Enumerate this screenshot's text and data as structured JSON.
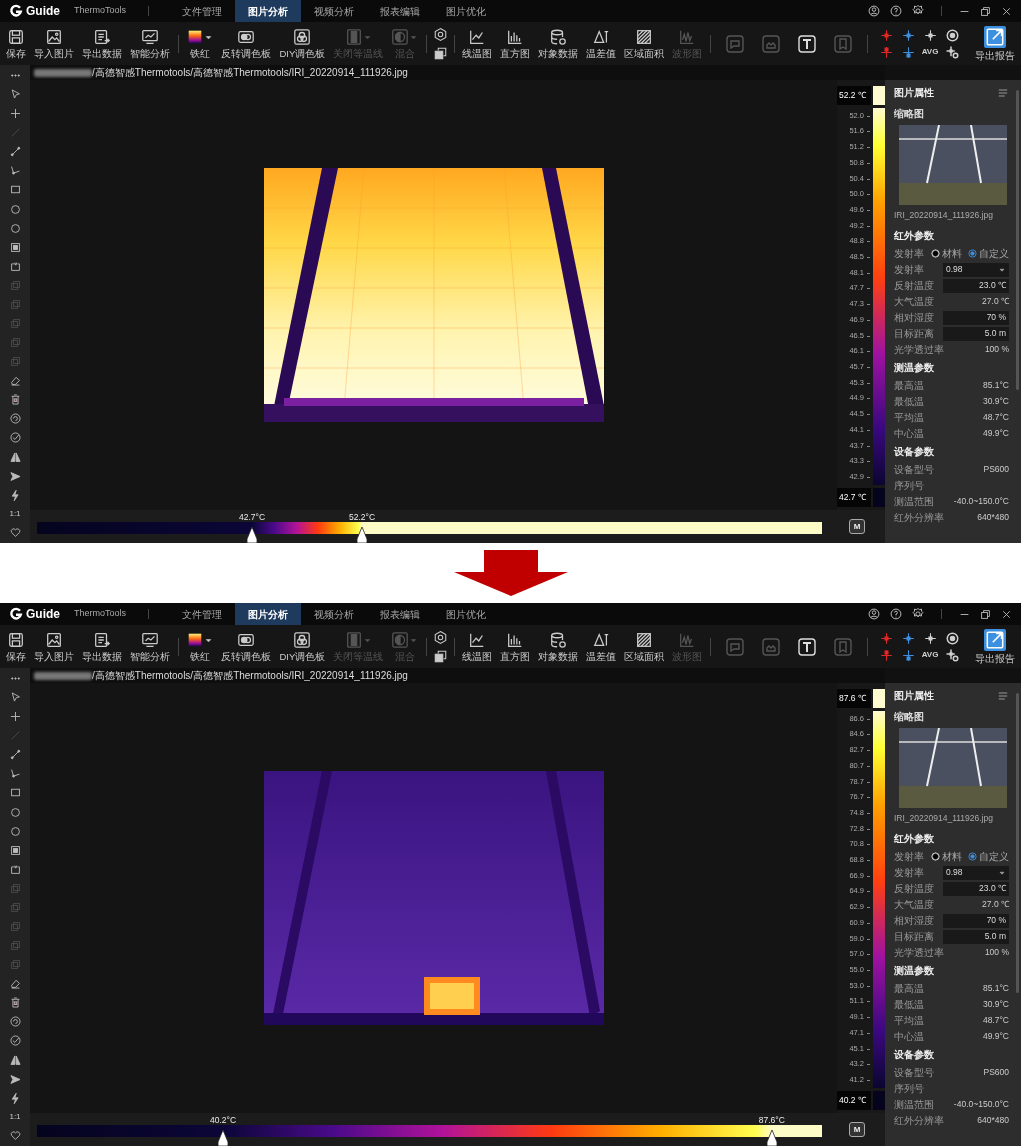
{
  "screens": [
    {
      "title_bar": {
        "logo_text": "Guide",
        "app_name": "ThermoTools",
        "tabs": [
          {
            "label": "文件管理",
            "selected": false
          },
          {
            "label": "图片分析",
            "selected": true
          },
          {
            "label": "视频分析",
            "selected": false
          },
          {
            "label": "报表编辑",
            "selected": false
          },
          {
            "label": "图片优化",
            "selected": false
          }
        ]
      },
      "toolbar": {
        "groups": [
          {
            "kind": "labeled",
            "items": [
              {
                "label": "保存",
                "disabled": false
              },
              {
                "label": "导入图片",
                "disabled": false
              },
              {
                "label": "导出数据",
                "disabled": false
              },
              {
                "label": "智能分析",
                "disabled": false
              }
            ]
          },
          {
            "kind": "labeled",
            "items": [
              {
                "label": "铁红",
                "disabled": false,
                "dropdown": true
              },
              {
                "label": "反转调色板",
                "disabled": false
              },
              {
                "label": "DIY调色板",
                "disabled": false
              },
              {
                "label": "关闭等温线",
                "disabled": true,
                "dropdown": true
              },
              {
                "label": "混合",
                "disabled": true,
                "dropdown": true
              }
            ]
          },
          {
            "kind": "stack",
            "items": [
              {
                "disabled": false
              },
              {
                "disabled": false
              }
            ]
          },
          {
            "kind": "labeled",
            "items": [
              {
                "label": "线温图",
                "disabled": false
              },
              {
                "label": "直方图",
                "disabled": false
              },
              {
                "label": "对象数据",
                "disabled": false
              },
              {
                "label": "温差值",
                "disabled": false
              },
              {
                "label": "区域面积",
                "disabled": false
              },
              {
                "label": "波形图",
                "disabled": true
              }
            ]
          },
          {
            "kind": "framed",
            "items": [
              {
                "disabled": true
              },
              {
                "disabled": true
              },
              {
                "disabled": false
              },
              {
                "disabled": true
              }
            ]
          },
          {
            "kind": "grid",
            "items": [
              {
                "color": "#e02828"
              },
              {
                "color": "#3d8fe0"
              },
              {
                "color": "#d0d0d0"
              },
              {
                "color": "#d0d0d0"
              },
              {
                "color": "#e02828"
              },
              {
                "color": "#3d8fe0"
              },
              {
                "text": "AVG",
                "color": "#d0d0d0"
              },
              {
                "color": "#d0d0d0"
              }
            ]
          },
          {
            "kind": "primary",
            "items": [
              {
                "label": "导出报告"
              }
            ]
          }
        ]
      },
      "left_tools": [
        {
          "disabled": false
        },
        {
          "disabled": false
        },
        {
          "disabled": false
        },
        {
          "disabled": true
        },
        {
          "disabled": false
        },
        {
          "disabled": false
        },
        {
          "disabled": false
        },
        {
          "disabled": false
        },
        {
          "disabled": false
        },
        {
          "disabled": false
        },
        {
          "disabled": false
        },
        {
          "disabled": true
        },
        {
          "disabled": true
        },
        {
          "disabled": true
        },
        {
          "disabled": true
        },
        {
          "disabled": true
        },
        {
          "disabled": false
        },
        {
          "disabled": false
        },
        {
          "disabled": false
        },
        {
          "disabled": false
        },
        {
          "disabled": false
        },
        {
          "disabled": false
        },
        {
          "disabled": false
        },
        {
          "text": "1:1",
          "disabled": false
        },
        {
          "disabled": false
        }
      ],
      "file_path": "/高德智感Thermotools/高德智感Thermotools/IRI_20220914_111926.jpg",
      "thermal_image": {
        "kind": "saturated"
      },
      "color_scale": {
        "max": "52.2 ℃",
        "min": "42.7 ℃",
        "ticks": [
          "52.0",
          "51.6",
          "51.2",
          "50.8",
          "50.4",
          "50.0",
          "49.6",
          "49.2",
          "48.8",
          "48.5",
          "48.1",
          "47.7",
          "47.3",
          "46.9",
          "46.5",
          "46.1",
          "45.7",
          "45.3",
          "44.9",
          "44.5",
          "44.1",
          "43.7",
          "43.3",
          "42.9"
        ]
      },
      "palette_bar": {
        "markers": [
          {
            "label": "42.7°C",
            "level": 0.274
          },
          {
            "label": "52.2°C",
            "level": 0.414
          }
        ],
        "mode_button": "M"
      },
      "properties": {
        "title": "图片属性",
        "thumbnail_label": "缩略图",
        "file_name": "IRI_20220914_111926.jpg",
        "sections": [
          {
            "title": "红外参数",
            "rows": [
              {
                "kind": "radio",
                "label": "发射率",
                "options": [
                  {
                    "label": "材料",
                    "selected": false
                  },
                  {
                    "label": "自定义",
                    "selected": true
                  }
                ]
              },
              {
                "kind": "select",
                "label": "发射率",
                "value": "0.98"
              },
              {
                "kind": "field",
                "label": "反射温度",
                "value": "23.0 ℃"
              },
              {
                "kind": "plain",
                "label": "大气温度",
                "value": "27.0 ℃"
              },
              {
                "kind": "field",
                "label": "相对湿度",
                "value": "70 %"
              },
              {
                "kind": "field",
                "label": "目标距离",
                "value": "5.0 m"
              },
              {
                "kind": "plain",
                "label": "光学透过率",
                "value": "100 %"
              }
            ]
          },
          {
            "title": "测温参数",
            "rows": [
              {
                "kind": "plain",
                "label": "最高温",
                "value": "85.1°C"
              },
              {
                "kind": "plain",
                "label": "最低温",
                "value": "30.9°C"
              },
              {
                "kind": "plain",
                "label": "平均温",
                "value": "48.7°C"
              },
              {
                "kind": "plain",
                "label": "中心温",
                "value": "49.9°C"
              }
            ]
          },
          {
            "title": "设备参数",
            "rows": [
              {
                "kind": "plain",
                "label": "设备型号",
                "value": "PS600"
              },
              {
                "kind": "plain",
                "label": "序列号"
              },
              {
                "kind": "plain",
                "label": "测温范围",
                "value": "-40.0~150.0°C"
              },
              {
                "kind": "plain",
                "label": "红外分辨率",
                "value": "640*480"
              }
            ]
          }
        ]
      }
    },
    {
      "title_bar": {
        "logo_text": "Guide",
        "app_name": "ThermoTools",
        "tabs": [
          {
            "label": "文件管理",
            "selected": false
          },
          {
            "label": "图片分析",
            "selected": true
          },
          {
            "label": "视频分析",
            "selected": false
          },
          {
            "label": "报表编辑",
            "selected": false
          },
          {
            "label": "图片优化",
            "selected": false
          }
        ]
      },
      "toolbar": {
        "groups": [
          {
            "kind": "labeled",
            "items": [
              {
                "label": "保存",
                "disabled": false
              },
              {
                "label": "导入图片",
                "disabled": false
              },
              {
                "label": "导出数据",
                "disabled": false
              },
              {
                "label": "智能分析",
                "disabled": false
              }
            ]
          },
          {
            "kind": "labeled",
            "items": [
              {
                "label": "铁红",
                "disabled": false,
                "dropdown": true
              },
              {
                "label": "反转调色板",
                "disabled": false
              },
              {
                "label": "DIY调色板",
                "disabled": false
              },
              {
                "label": "关闭等温线",
                "disabled": true,
                "dropdown": true
              },
              {
                "label": "混合",
                "disabled": true,
                "dropdown": true
              }
            ]
          },
          {
            "kind": "stack",
            "items": [
              {
                "disabled": false
              },
              {
                "disabled": false
              }
            ]
          },
          {
            "kind": "labeled",
            "items": [
              {
                "label": "线温图",
                "disabled": false
              },
              {
                "label": "直方图",
                "disabled": false
              },
              {
                "label": "对象数据",
                "disabled": false
              },
              {
                "label": "温差值",
                "disabled": false
              },
              {
                "label": "区域面积",
                "disabled": false
              },
              {
                "label": "波形图",
                "disabled": true
              }
            ]
          },
          {
            "kind": "framed",
            "items": [
              {
                "disabled": true
              },
              {
                "disabled": true
              },
              {
                "disabled": false
              },
              {
                "disabled": true
              }
            ]
          },
          {
            "kind": "grid",
            "items": [
              {
                "color": "#e02828"
              },
              {
                "color": "#3d8fe0"
              },
              {
                "color": "#d0d0d0"
              },
              {
                "color": "#d0d0d0"
              },
              {
                "color": "#e02828"
              },
              {
                "color": "#3d8fe0"
              },
              {
                "text": "AVG",
                "color": "#d0d0d0"
              },
              {
                "color": "#d0d0d0"
              }
            ]
          },
          {
            "kind": "primary",
            "items": [
              {
                "label": "导出报告"
              }
            ]
          }
        ]
      },
      "left_tools": [
        {
          "disabled": false
        },
        {
          "disabled": false
        },
        {
          "disabled": false
        },
        {
          "disabled": true
        },
        {
          "disabled": false
        },
        {
          "disabled": false
        },
        {
          "disabled": false
        },
        {
          "disabled": false
        },
        {
          "disabled": false
        },
        {
          "disabled": false
        },
        {
          "disabled": false
        },
        {
          "disabled": true
        },
        {
          "disabled": true
        },
        {
          "disabled": true
        },
        {
          "disabled": true
        },
        {
          "disabled": true
        },
        {
          "disabled": false
        },
        {
          "disabled": false
        },
        {
          "disabled": false
        },
        {
          "disabled": false
        },
        {
          "disabled": false
        },
        {
          "disabled": false
        },
        {
          "disabled": false
        },
        {
          "text": "1:1",
          "disabled": false
        },
        {
          "disabled": false
        }
      ],
      "file_path": "/高德智感Thermotools/高德智感Thermotools/IRI_20220914_111926.jpg",
      "thermal_image": {
        "kind": "hotspot"
      },
      "color_scale": {
        "max": "87.6 ℃",
        "min": "40.2 ℃",
        "ticks": [
          "86.6",
          "84.6",
          "82.7",
          "80.7",
          "78.7",
          "76.7",
          "74.8",
          "72.8",
          "70.8",
          "68.8",
          "66.9",
          "64.9",
          "62.9",
          "60.9",
          "59.0",
          "57.0",
          "55.0",
          "53.0",
          "51.1",
          "49.1",
          "47.1",
          "45.1",
          "43.2",
          "41.2"
        ]
      },
      "palette_bar": {
        "markers": [
          {
            "label": "40.2°C",
            "level": 0.237
          },
          {
            "label": "87.6°C",
            "level": 0.936
          }
        ],
        "mode_button": "M"
      },
      "properties": {
        "title": "图片属性",
        "thumbnail_label": "缩略图",
        "file_name": "IRI_20220914_111926.jpg",
        "sections": [
          {
            "title": "红外参数",
            "rows": [
              {
                "kind": "radio",
                "label": "发射率",
                "options": [
                  {
                    "label": "材料",
                    "selected": false
                  },
                  {
                    "label": "自定义",
                    "selected": true
                  }
                ]
              },
              {
                "kind": "select",
                "label": "发射率",
                "value": "0.98"
              },
              {
                "kind": "field",
                "label": "反射温度",
                "value": "23.0 ℃"
              },
              {
                "kind": "plain",
                "label": "大气温度",
                "value": "27.0 ℃"
              },
              {
                "kind": "field",
                "label": "相对湿度",
                "value": "70 %"
              },
              {
                "kind": "field",
                "label": "目标距离",
                "value": "5.0 m"
              },
              {
                "kind": "plain",
                "label": "光学透过率",
                "value": "100 %"
              }
            ]
          },
          {
            "title": "测温参数",
            "rows": [
              {
                "kind": "plain",
                "label": "最高温",
                "value": "85.1°C"
              },
              {
                "kind": "plain",
                "label": "最低温",
                "value": "30.9°C"
              },
              {
                "kind": "plain",
                "label": "平均温",
                "value": "48.7°C"
              },
              {
                "kind": "plain",
                "label": "中心温",
                "value": "49.9°C"
              }
            ]
          },
          {
            "title": "设备参数",
            "rows": [
              {
                "kind": "plain",
                "label": "设备型号",
                "value": "PS600"
              },
              {
                "kind": "plain",
                "label": "序列号"
              },
              {
                "kind": "plain",
                "label": "测温范围",
                "value": "-40.0~150.0°C"
              },
              {
                "kind": "plain",
                "label": "红外分辨率",
                "value": "640*480"
              }
            ]
          }
        ]
      }
    }
  ]
}
